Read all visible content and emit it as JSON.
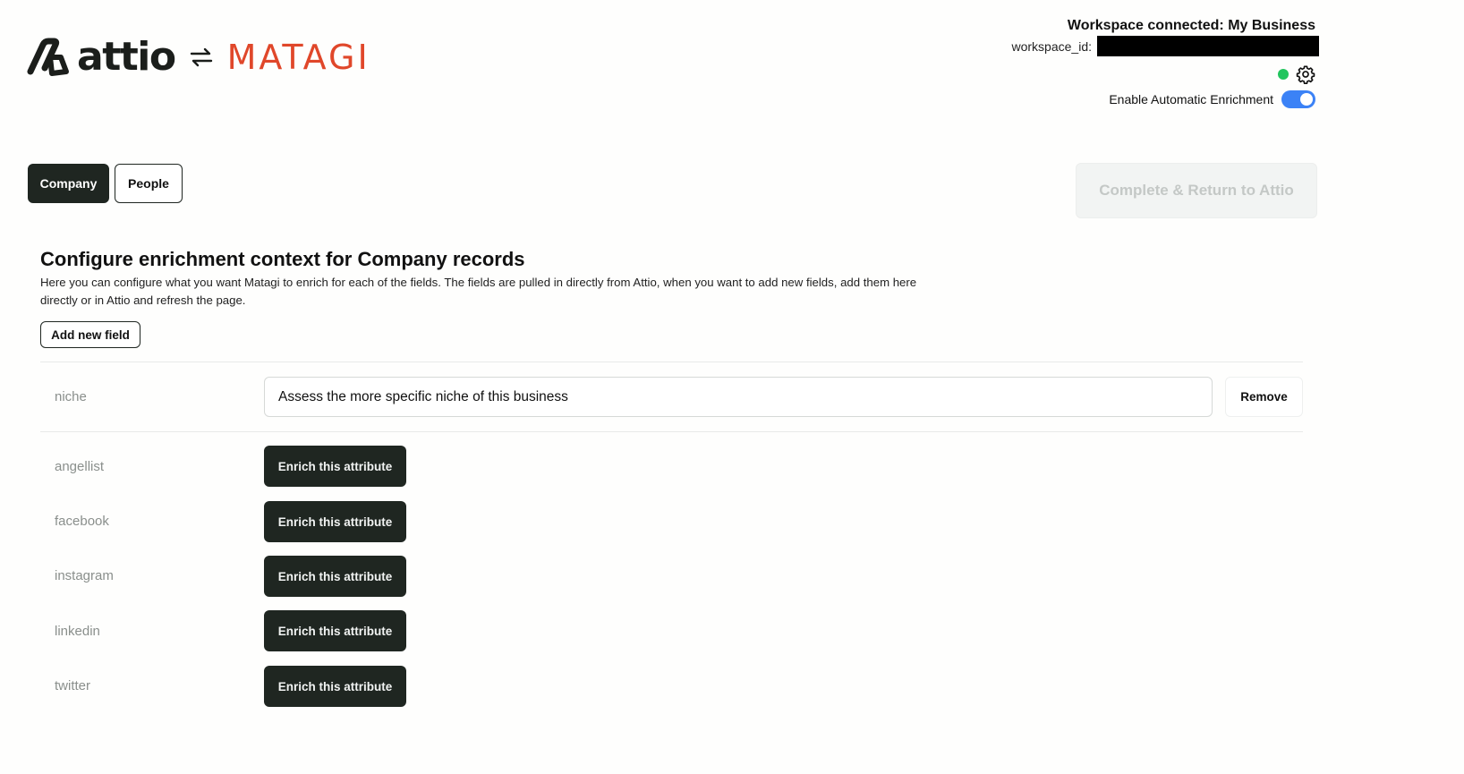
{
  "header": {
    "brand_left": "attio",
    "brand_right": "MATAGI",
    "workspace_title": "Workspace connected: My Business",
    "workspace_id_label": "workspace_id:",
    "workspace_id_value": "",
    "auto_enrichment_label": "Enable Automatic Enrichment",
    "auto_enrichment_enabled": true,
    "status_color": "#22c55e",
    "toggle_color": "#3b82f6"
  },
  "tabs": [
    {
      "label": "Company",
      "active": true
    },
    {
      "label": "People",
      "active": false
    }
  ],
  "complete_button": {
    "label": "Complete & Return to Attio",
    "disabled": true
  },
  "section": {
    "title": "Configure enrichment context for Company records",
    "description": "Here you can configure what you want Matagi to enrich for each of the fields. The fields are pulled in directly from Attio, when you want to add new fields, add them here directly or in Attio and refresh the page.",
    "add_field_label": "Add new field"
  },
  "configured_fields": [
    {
      "name": "niche",
      "value": "Assess the more specific niche of this business",
      "remove_label": "Remove"
    }
  ],
  "enrich_fields": [
    {
      "name": "angellist",
      "button_label": "Enrich this attribute"
    },
    {
      "name": "facebook",
      "button_label": "Enrich this attribute"
    },
    {
      "name": "instagram",
      "button_label": "Enrich this attribute"
    },
    {
      "name": "linkedin",
      "button_label": "Enrich this attribute"
    },
    {
      "name": "twitter",
      "button_label": "Enrich this attribute"
    }
  ],
  "icons": {
    "brand_mark": "attio-logo-icon",
    "swap": "swap-arrows-icon",
    "settings": "gear-icon",
    "status": "status-dot-icon"
  }
}
